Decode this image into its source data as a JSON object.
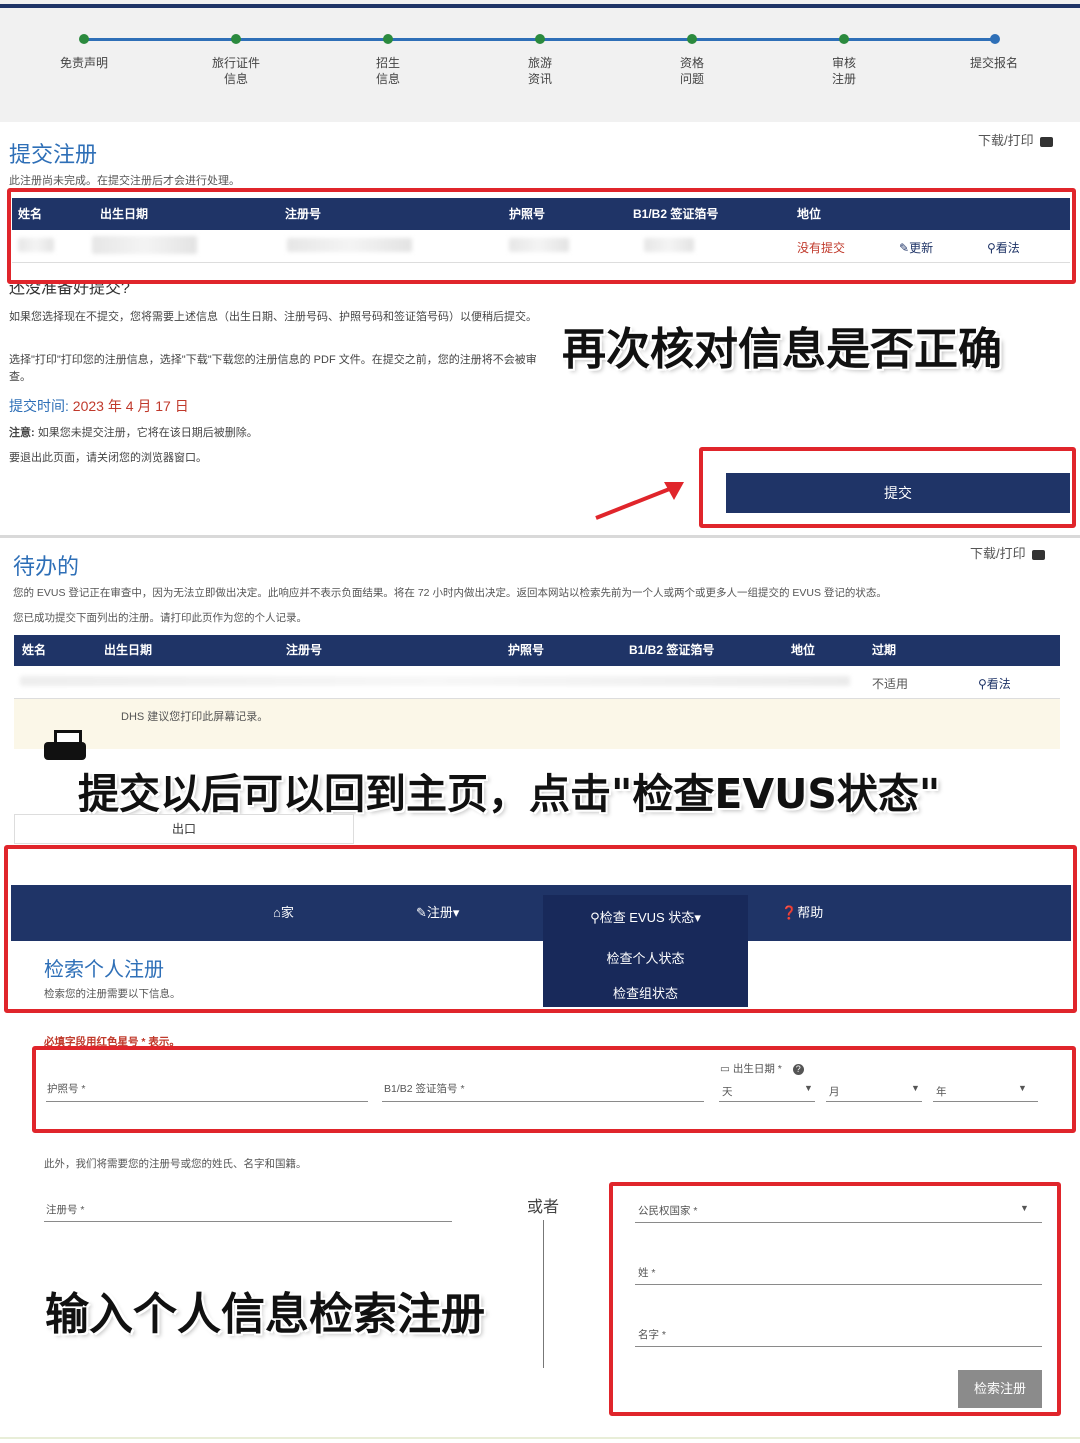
{
  "stepper": {
    "steps": [
      {
        "label": "免责声明"
      },
      {
        "label": "旅行证件\n信息"
      },
      {
        "label": "招生\n信息"
      },
      {
        "label": "旅游\n资讯"
      },
      {
        "label": "资格\n问题"
      },
      {
        "label": "审核\n注册"
      },
      {
        "label": "提交报名"
      }
    ],
    "line_color": "#2e6fb7",
    "dot_color": "#2b8a3e",
    "last_dot_color": "#2e6fb7"
  },
  "submit_section": {
    "title": "提交注册",
    "download_print": "下载/打印",
    "notice": "此注册尚未完成。在提交注册后才会进行处理。",
    "table_headers": [
      "姓名",
      "出生日期",
      "注册号",
      "护照号",
      "B1/B2 签证箔号",
      "地位"
    ],
    "row": {
      "status": "没有提交",
      "update": "更新",
      "view": "看法"
    },
    "not_ready_heading": "还没准备好提交?",
    "para1": "如果您选择现在不提交，您将需要上述信息（出生日期、注册号码、护照号码和签证箔号码）以便稍后提交。",
    "para2": "选择\"打印\"打印您的注册信息，选择\"下载\"下载您的注册信息的 PDF 文件。在提交之前，您的注册将不会被审查。",
    "submit_time_label": "提交时间:",
    "submit_time_value": "2023 年 4 月 17 日",
    "note_bold": "注意:",
    "note_text": "如果您未提交注册，它将在该日期后被删除。",
    "exit_text": "要退出此页面，请关闭您的浏览器窗口。",
    "submit_button": "提交"
  },
  "annotations": {
    "caption1": "再次核对信息是否正确",
    "caption2": "提交以后可以回到主页，点击\"检查EVUS状态\"",
    "caption3": "输入个人信息检索注册"
  },
  "pending_section": {
    "title": "待办的",
    "download_print": "下载/打印",
    "para1": "您的 EVUS 登记正在审查中，因为无法立即做出决定。此响应并不表示负面结果。将在 72 小时内做出决定。返回本网站以检索先前为一个人或两个或更多人一组提交的 EVUS 登记的状态。",
    "para2": "您已成功提交下面列出的注册。请打印此页作为您的个人记录。",
    "table_headers": [
      "姓名",
      "出生日期",
      "注册号",
      "护照号",
      "B1/B2 签证箔号",
      "地位",
      "过期"
    ],
    "row": {
      "expiry": "不适用",
      "view": "看法"
    },
    "dhs_note": "DHS 建议您打印此屏幕记录。",
    "exit_label": "出口"
  },
  "navbar": {
    "home": "家",
    "register": "注册",
    "check_status": "检查 EVUS 状态",
    "help": "帮助",
    "dropdown": [
      "检查个人状态",
      "检查组状态"
    ]
  },
  "search_section": {
    "title": "检索个人注册",
    "subtitle": "检索您的注册需要以下信息。",
    "required_note": "必填字段用红色星号 * 表示。",
    "passport_label": "护照号 *",
    "visa_label": "B1/B2 签证箔号 *",
    "dob_label": "出生日期 *",
    "day": "天",
    "month": "月",
    "year": "年",
    "also_note": "此外，我们将需要您的注册号或您的姓氏、名字和国籍。",
    "reg_no_label": "注册号 *",
    "or_label": "或者",
    "country_label": "公民权国家 *",
    "surname_label": "姓 *",
    "given_label": "名字 *",
    "search_button": "检索注册"
  },
  "colors": {
    "navy": "#1f3467",
    "annotation_red": "#e0252b",
    "accent_red": "#c0392b"
  }
}
